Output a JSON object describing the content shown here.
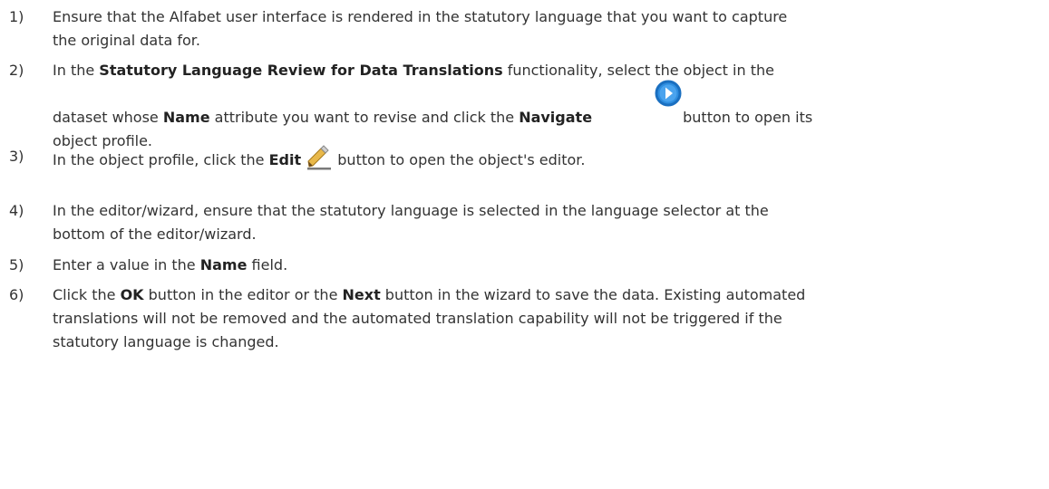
{
  "steps": [
    {
      "number": "1)",
      "parts": [
        {
          "text": "Ensure that the Alfabet user interface is rendered in the statutory language that you want to capture"
        },
        {
          "text": "the original data for."
        }
      ]
    },
    {
      "number": "2)",
      "line1_a": "In the ",
      "line1_bold": "Statutory Language Review for Data Translations",
      "line1_b": " functionality, select the object in the",
      "line2_a": "dataset whose ",
      "line2_bold1": "Name",
      "line2_b": " attribute you want to revise and click the ",
      "line2_bold2": "Navigate",
      "line2_c": " button to open its",
      "line3": "object profile."
    },
    {
      "number": "3)",
      "a": "In the object profile, click the ",
      "bold": "Edit",
      "b": " button to open the object's editor."
    },
    {
      "number": "4)",
      "line1": "In the editor/wizard, ensure that the statutory language is selected in the language selector at the",
      "line2": "bottom of the editor/wizard."
    },
    {
      "number": "5)",
      "a": "Enter a value in the ",
      "bold": "Name",
      "b": " field."
    },
    {
      "number": "6)",
      "a": "Click the ",
      "bold1": "OK",
      "b": " button in the editor or the ",
      "bold2": "Next",
      "c": " button in the wizard to save the data. Existing automated",
      "line2": "translations will not be removed and the automated translation capability will not be triggered if the",
      "line3": "statutory language is changed."
    }
  ],
  "icons": {
    "navigate": "navigate-arrow-icon",
    "edit": "pencil-edit-icon"
  },
  "colors": {
    "text": "#333333",
    "navigate_ring": "#1a6fc0",
    "navigate_fill": "#2f8ee0",
    "pencil_body": "#e8b84a",
    "pencil_tip": "#6b4a1e"
  }
}
